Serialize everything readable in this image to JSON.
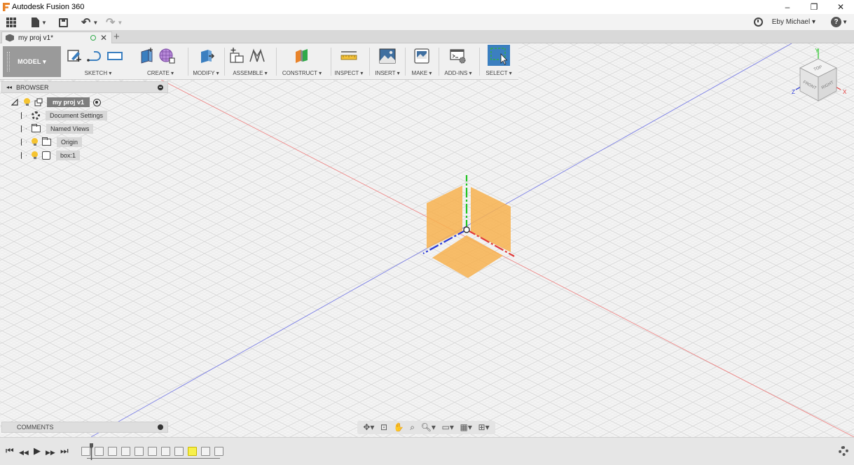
{
  "app": {
    "title": "Autodesk Fusion 360",
    "window_controls": {
      "minimize": "–",
      "restore": "❐",
      "close": "✕"
    }
  },
  "qat": {
    "user": "Eby Michael ▾",
    "undo": "↶",
    "redo": "↷"
  },
  "document_tab": {
    "name": "my proj v1*",
    "close": "✕",
    "new_tab": "+"
  },
  "ribbon": {
    "workspace": "MODEL ▾",
    "groups": [
      {
        "label": "SKETCH ▾"
      },
      {
        "label": "CREATE ▾"
      },
      {
        "label": "MODIFY ▾"
      },
      {
        "label": "ASSEMBLE ▾"
      },
      {
        "label": "CONSTRUCT ▾"
      },
      {
        "label": "INSPECT ▾"
      },
      {
        "label": "INSERT ▾"
      },
      {
        "label": "MAKE ▾"
      },
      {
        "label": "ADD-INS ▾"
      },
      {
        "label": "SELECT ▾"
      }
    ]
  },
  "browser": {
    "title": "BROWSER",
    "collapse": "◂◂",
    "root": "my proj v1",
    "items": [
      {
        "label": "Document Settings"
      },
      {
        "label": "Named Views"
      },
      {
        "label": "Origin"
      },
      {
        "label": "box:1"
      }
    ]
  },
  "viewcube": {
    "faces": {
      "top": "TOP",
      "front": "FRONT",
      "right": "RIGHT"
    },
    "axes": {
      "x": "X",
      "y": "Y",
      "z": "Z"
    }
  },
  "comments": {
    "title": "COMMENTS"
  },
  "navbar": {
    "orbit": "✥▾",
    "look_at": "⊡",
    "pan": "✋",
    "zoom_window": "⌕",
    "zoom": "🔍︎▾",
    "display": "▭▾",
    "grid": "▦▾",
    "viewports": "⊞▾"
  },
  "timeline": {
    "first": "⏮",
    "prev": "◀◀",
    "play": "▶",
    "next": "▶▶",
    "last": "⏭"
  },
  "colors": {
    "x_axis": "#e03a3a",
    "y_axis": "#22c322",
    "z_axis": "#2a3ad8",
    "origin_plane": "#f7b14f",
    "select_blue": "#3b7fc0"
  }
}
